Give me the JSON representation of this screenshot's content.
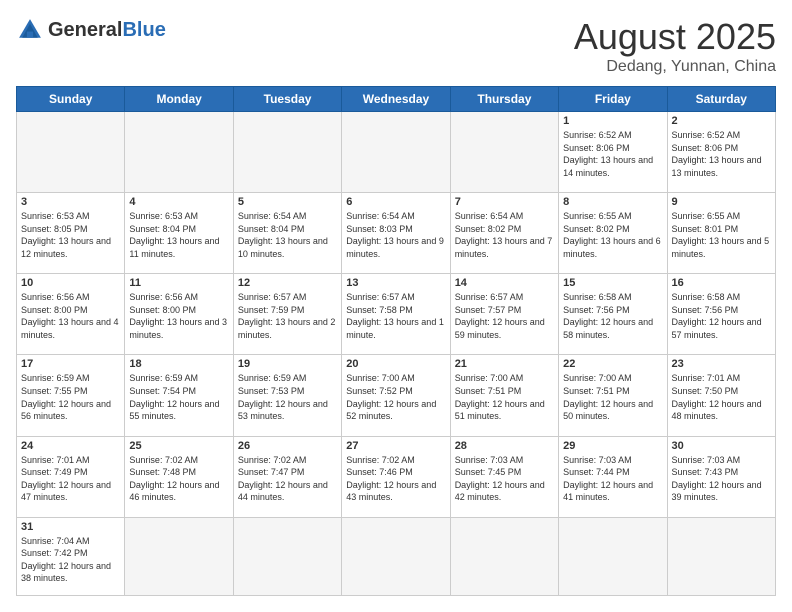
{
  "header": {
    "logo_general": "General",
    "logo_blue": "Blue",
    "month_title": "August 2025",
    "location": "Dedang, Yunnan, China"
  },
  "weekdays": [
    "Sunday",
    "Monday",
    "Tuesday",
    "Wednesday",
    "Thursday",
    "Friday",
    "Saturday"
  ],
  "days": {
    "1": {
      "sunrise": "6:52 AM",
      "sunset": "8:06 PM",
      "daylight": "13 hours and 14 minutes."
    },
    "2": {
      "sunrise": "6:52 AM",
      "sunset": "8:06 PM",
      "daylight": "13 hours and 13 minutes."
    },
    "3": {
      "sunrise": "6:53 AM",
      "sunset": "8:05 PM",
      "daylight": "13 hours and 12 minutes."
    },
    "4": {
      "sunrise": "6:53 AM",
      "sunset": "8:04 PM",
      "daylight": "13 hours and 11 minutes."
    },
    "5": {
      "sunrise": "6:54 AM",
      "sunset": "8:04 PM",
      "daylight": "13 hours and 10 minutes."
    },
    "6": {
      "sunrise": "6:54 AM",
      "sunset": "8:03 PM",
      "daylight": "13 hours and 9 minutes."
    },
    "7": {
      "sunrise": "6:54 AM",
      "sunset": "8:02 PM",
      "daylight": "13 hours and 7 minutes."
    },
    "8": {
      "sunrise": "6:55 AM",
      "sunset": "8:02 PM",
      "daylight": "13 hours and 6 minutes."
    },
    "9": {
      "sunrise": "6:55 AM",
      "sunset": "8:01 PM",
      "daylight": "13 hours and 5 minutes."
    },
    "10": {
      "sunrise": "6:56 AM",
      "sunset": "8:00 PM",
      "daylight": "13 hours and 4 minutes."
    },
    "11": {
      "sunrise": "6:56 AM",
      "sunset": "8:00 PM",
      "daylight": "13 hours and 3 minutes."
    },
    "12": {
      "sunrise": "6:57 AM",
      "sunset": "7:59 PM",
      "daylight": "13 hours and 2 minutes."
    },
    "13": {
      "sunrise": "6:57 AM",
      "sunset": "7:58 PM",
      "daylight": "13 hours and 1 minute."
    },
    "14": {
      "sunrise": "6:57 AM",
      "sunset": "7:57 PM",
      "daylight": "12 hours and 59 minutes."
    },
    "15": {
      "sunrise": "6:58 AM",
      "sunset": "7:56 PM",
      "daylight": "12 hours and 58 minutes."
    },
    "16": {
      "sunrise": "6:58 AM",
      "sunset": "7:56 PM",
      "daylight": "12 hours and 57 minutes."
    },
    "17": {
      "sunrise": "6:59 AM",
      "sunset": "7:55 PM",
      "daylight": "12 hours and 56 minutes."
    },
    "18": {
      "sunrise": "6:59 AM",
      "sunset": "7:54 PM",
      "daylight": "12 hours and 55 minutes."
    },
    "19": {
      "sunrise": "6:59 AM",
      "sunset": "7:53 PM",
      "daylight": "12 hours and 53 minutes."
    },
    "20": {
      "sunrise": "7:00 AM",
      "sunset": "7:52 PM",
      "daylight": "12 hours and 52 minutes."
    },
    "21": {
      "sunrise": "7:00 AM",
      "sunset": "7:51 PM",
      "daylight": "12 hours and 51 minutes."
    },
    "22": {
      "sunrise": "7:00 AM",
      "sunset": "7:51 PM",
      "daylight": "12 hours and 50 minutes."
    },
    "23": {
      "sunrise": "7:01 AM",
      "sunset": "7:50 PM",
      "daylight": "12 hours and 48 minutes."
    },
    "24": {
      "sunrise": "7:01 AM",
      "sunset": "7:49 PM",
      "daylight": "12 hours and 47 minutes."
    },
    "25": {
      "sunrise": "7:02 AM",
      "sunset": "7:48 PM",
      "daylight": "12 hours and 46 minutes."
    },
    "26": {
      "sunrise": "7:02 AM",
      "sunset": "7:47 PM",
      "daylight": "12 hours and 44 minutes."
    },
    "27": {
      "sunrise": "7:02 AM",
      "sunset": "7:46 PM",
      "daylight": "12 hours and 43 minutes."
    },
    "28": {
      "sunrise": "7:03 AM",
      "sunset": "7:45 PM",
      "daylight": "12 hours and 42 minutes."
    },
    "29": {
      "sunrise": "7:03 AM",
      "sunset": "7:44 PM",
      "daylight": "12 hours and 41 minutes."
    },
    "30": {
      "sunrise": "7:03 AM",
      "sunset": "7:43 PM",
      "daylight": "12 hours and 39 minutes."
    },
    "31": {
      "sunrise": "7:04 AM",
      "sunset": "7:42 PM",
      "daylight": "12 hours and 38 minutes."
    }
  },
  "labels": {
    "sunrise_prefix": "Sunrise: ",
    "sunset_prefix": "Sunset: ",
    "daylight_prefix": "Daylight: "
  }
}
